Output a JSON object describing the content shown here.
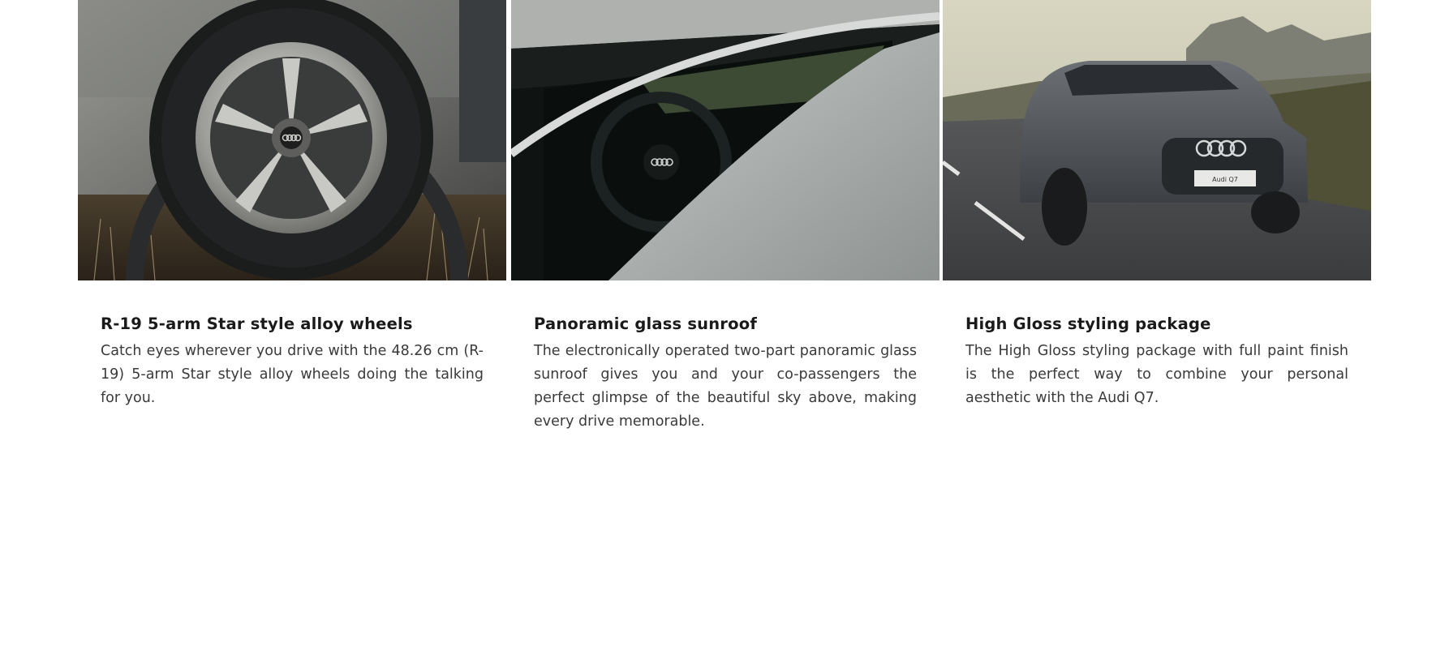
{
  "features": [
    {
      "image_subject": "alloy-wheel",
      "title": "R-19 5-arm Star style alloy wheels",
      "description": "Catch eyes wherever you drive with the 48.26 cm (R-19) 5-arm Star style alloy wheels doing the talking for you."
    },
    {
      "image_subject": "panoramic-sunroof",
      "title": "Panoramic glass sunroof",
      "description": "The electronically operated two-part panoramic glass sunroof gives you and your co-passengers the perfect glimpse of the beautiful sky above, making every drive memorable."
    },
    {
      "image_subject": "car-on-road",
      "title": "High Gloss styling package",
      "description": "The High Gloss styling package with full paint finish is the perfect way to combine your personal aesthetic with the Audi Q7."
    }
  ],
  "car_plate_text": "Audi Q7",
  "colors": {
    "title": "#1a1a1a",
    "body_text": "#3a3a3a",
    "background": "#ffffff"
  }
}
